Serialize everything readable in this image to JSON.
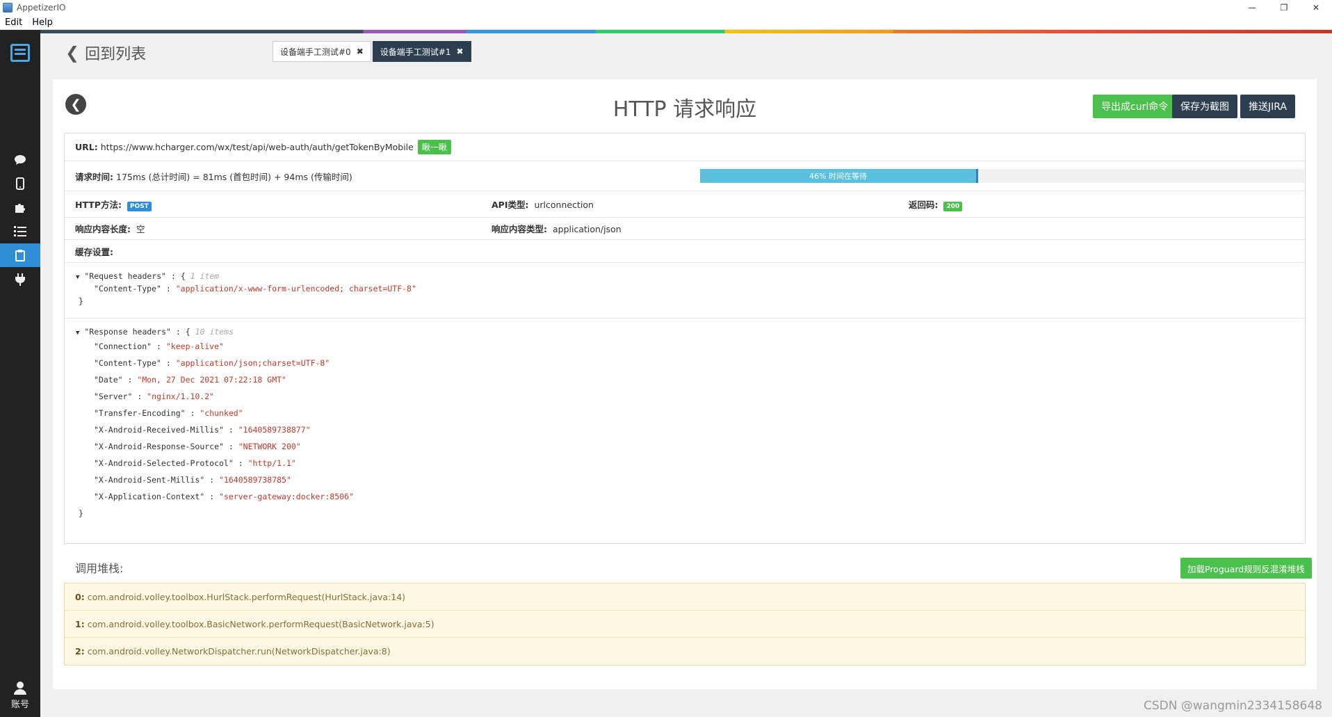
{
  "window": {
    "title": "AppetizerIO",
    "minimize": "—",
    "maximize": "❐",
    "close": "✕"
  },
  "menu": [
    "Edit",
    "Help"
  ],
  "sidebar": {
    "account_label": "账号"
  },
  "header": {
    "back_label": "回到列表",
    "tabs": [
      {
        "label": "设备端手工测试#0",
        "active": false
      },
      {
        "label": "设备端手工测试#1",
        "active": true
      }
    ]
  },
  "card": {
    "title": "HTTP 请求响应",
    "buttons": {
      "export_curl": "导出成curl命令",
      "save_screenshot": "保存为截图",
      "push_jira": "推送JIRA"
    },
    "url": {
      "label": "URL:",
      "value": "https://www.hcharger.com/wx/test/api/web-auth/auth/getTokenByMobile",
      "look_btn": "瞅一瞅"
    },
    "request_time": {
      "label": "请求时间:",
      "value": "175ms (总计时间) = 81ms (首包时间) + 94ms (传输时间)",
      "progress_label": "46% 时间在等待",
      "wait_fraction": 0.46
    },
    "http_method": {
      "label": "HTTP方法:",
      "value": "POST"
    },
    "api_type": {
      "label": "API类型:",
      "value": "urlconnection"
    },
    "status_code": {
      "label": "返回码:",
      "value": "200"
    },
    "content_length": {
      "label": "响应内容长度:",
      "value": "空"
    },
    "content_type": {
      "label": "响应内容类型:",
      "value": "application/json"
    },
    "cache": {
      "label": "缓存设置:"
    },
    "request_headers": {
      "name": "\"Request headers\"",
      "count": "1 item",
      "items": [
        {
          "k": "\"Content-Type\"",
          "v": "\"application/x-www-form-urlencoded; charset=UTF-8\""
        }
      ]
    },
    "response_headers": {
      "name": "\"Response headers\"",
      "count": "10 items",
      "items": [
        {
          "k": "\"Connection\"",
          "v": "\"keep-alive\""
        },
        {
          "k": "\"Content-Type\"",
          "v": "\"application/json;charset=UTF-8\""
        },
        {
          "k": "\"Date\"",
          "v": "\"Mon, 27 Dec 2021 07:22:18 GMT\""
        },
        {
          "k": "\"Server\"",
          "v": "\"nginx/1.10.2\""
        },
        {
          "k": "\"Transfer-Encoding\"",
          "v": "\"chunked\""
        },
        {
          "k": "\"X-Android-Received-Millis\"",
          "v": "\"1640589738877\""
        },
        {
          "k": "\"X-Android-Response-Source\"",
          "v": "\"NETWORK 200\""
        },
        {
          "k": "\"X-Android-Selected-Protocol\"",
          "v": "\"http/1.1\""
        },
        {
          "k": "\"X-Android-Sent-Millis\"",
          "v": "\"1640589738785\""
        },
        {
          "k": "\"X-Application-Context\"",
          "v": "\"server-gateway:docker:8506\""
        }
      ]
    },
    "stack": {
      "title": "调用堆栈:",
      "proguard_btn": "加载Proguard规则反混淆堆栈",
      "frames": [
        {
          "idx": "0:",
          "text": "com.android.volley.toolbox.HurlStack.performRequest(HurlStack.java:14)"
        },
        {
          "idx": "1:",
          "text": "com.android.volley.toolbox.BasicNetwork.performRequest(BasicNetwork.java:5)"
        },
        {
          "idx": "2:",
          "text": "com.android.volley.NetworkDispatcher.run(NetworkDispatcher.java:8)"
        }
      ]
    }
  },
  "watermark": "CSDN @wangmin2334158648"
}
